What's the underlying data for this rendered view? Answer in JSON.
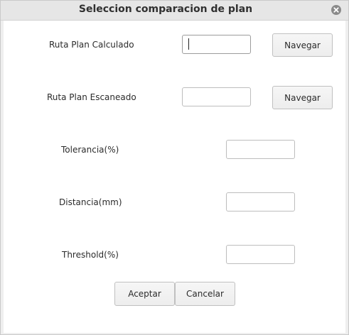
{
  "window": {
    "title": "Seleccion comparacion de plan",
    "close_icon": "close-icon"
  },
  "form": {
    "ruta_calculado_label": "Ruta Plan Calculado",
    "ruta_calculado_value": "",
    "ruta_escaneado_label": "Ruta Plan Escaneado",
    "ruta_escaneado_value": "",
    "navegar_label": "Navegar",
    "tolerancia_label": "Tolerancia(%)",
    "tolerancia_value": "",
    "distancia_label": "Distancia(mm)",
    "distancia_value": "",
    "threshold_label": "Threshold(%)",
    "threshold_value": ""
  },
  "actions": {
    "aceptar_label": "Aceptar",
    "cancelar_label": "Cancelar"
  }
}
